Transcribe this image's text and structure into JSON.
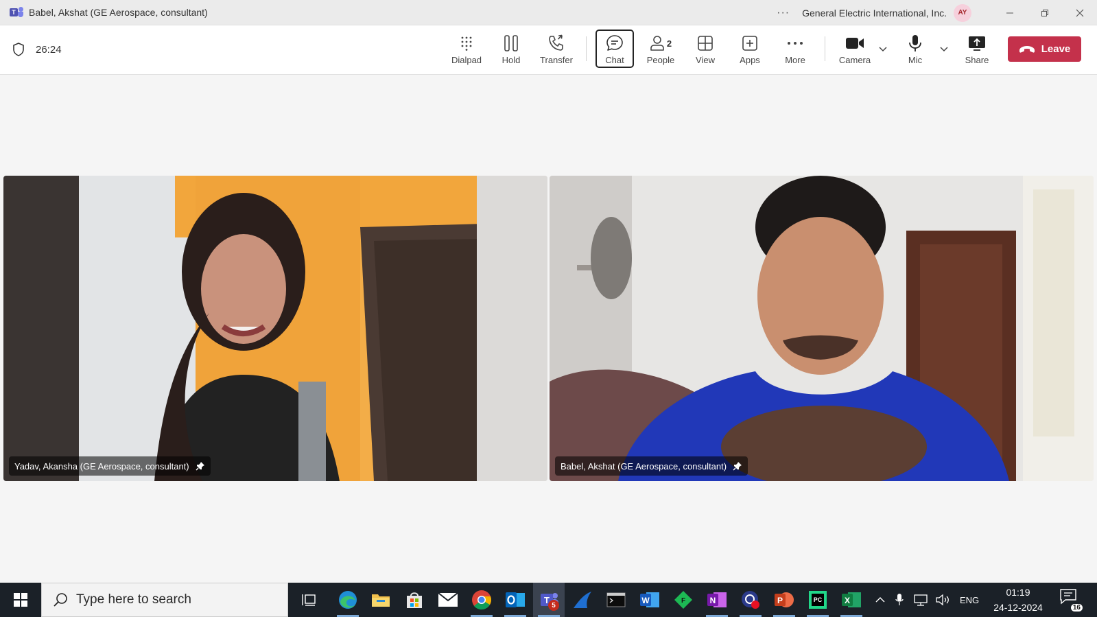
{
  "window": {
    "title": "Babel, Akshat (GE Aerospace, consultant)",
    "organization": "General Electric International, Inc.",
    "avatar_initials": "AY",
    "more_label": "···"
  },
  "meeting": {
    "elapsed": "26:24",
    "toolbar": {
      "dialpad": "Dialpad",
      "hold": "Hold",
      "transfer": "Transfer",
      "chat": "Chat",
      "people": "People",
      "people_count": "2",
      "view": "View",
      "apps": "Apps",
      "more": "More",
      "camera": "Camera",
      "mic": "Mic",
      "share": "Share",
      "leave": "Leave"
    }
  },
  "participants": [
    {
      "name": "Yadav, Akansha (GE Aerospace, consultant)",
      "pinned": true
    },
    {
      "name": "Babel, Akshat (GE Aerospace, consultant)",
      "pinned": true
    }
  ],
  "taskbar": {
    "search_placeholder": "Type here to search",
    "teams_badge": "5",
    "language": "ENG",
    "time": "01:19",
    "date": "24-12-2024",
    "notifications": "16"
  },
  "colors": {
    "leave": "#c4314b",
    "teams_accent": "#4f52b2",
    "taskbar": "#1b2128"
  }
}
